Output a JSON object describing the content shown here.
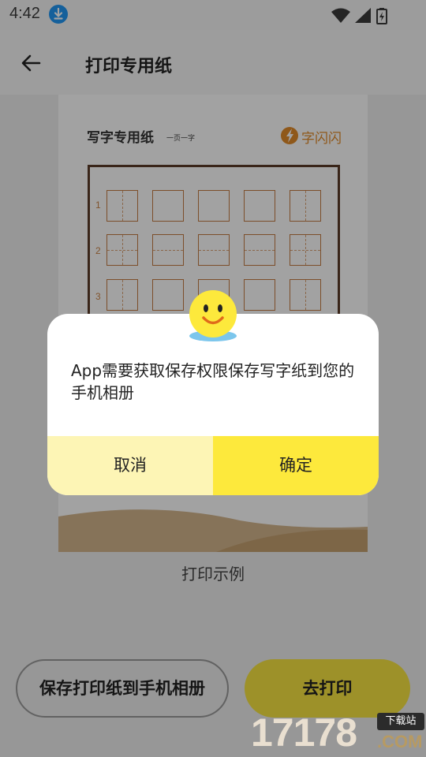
{
  "status_bar": {
    "time": "4:42"
  },
  "app_bar": {
    "title": "打印专用纸"
  },
  "paper": {
    "title": "写字专用纸",
    "subtitle": "一页一字",
    "logo_text": "字闪闪",
    "rows": [
      "1",
      "2",
      "3"
    ]
  },
  "sample_label": "打印示例",
  "buttons": {
    "save": "保存打印纸到手机相册",
    "print": "去打印"
  },
  "dialog": {
    "message": "App需要获取保存权限保存写字纸到您的手机相册",
    "cancel": "取消",
    "confirm": "确定"
  },
  "watermark": {
    "number": "17178",
    "tag": "下载站",
    "com": ".COM"
  },
  "colors": {
    "accent_yellow": "#fde93c",
    "cancel_bg": "#fdf5b5",
    "grid_brown": "#c27a42"
  },
  "icons": [
    "download-icon",
    "wifi-icon",
    "signal-icon",
    "battery-icon",
    "back-arrow-icon",
    "smiley-icon"
  ]
}
